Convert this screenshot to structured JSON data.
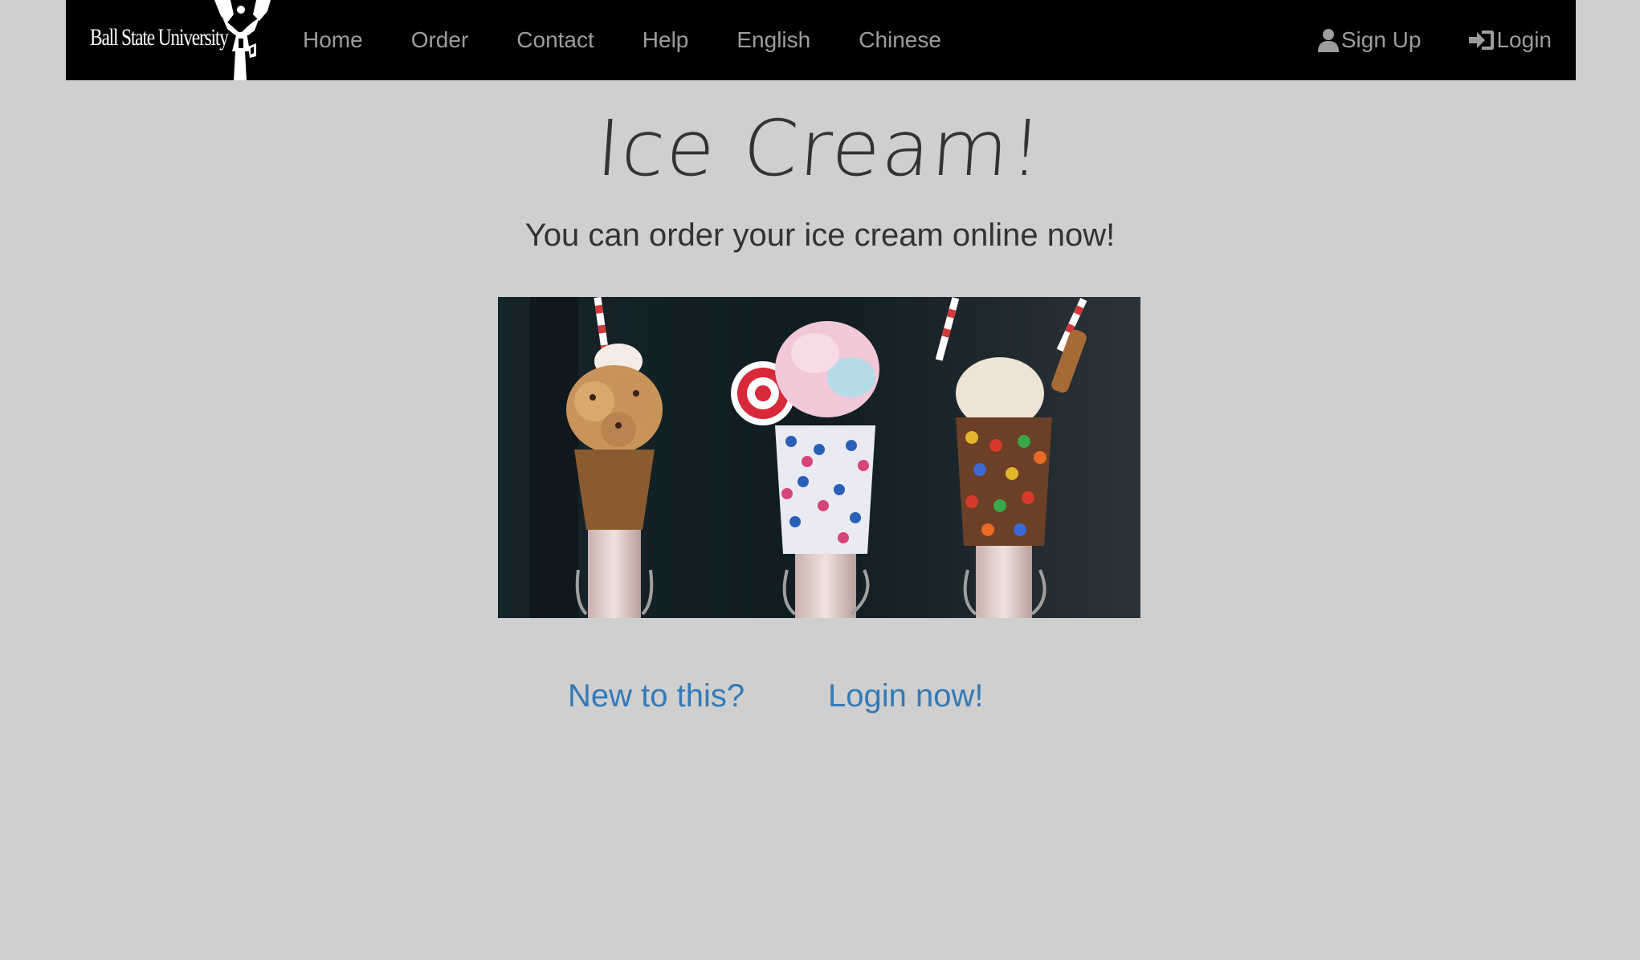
{
  "navbar": {
    "brand_text": "Ball State University",
    "brand_logo_icon": "cardinal-statue-icon",
    "left_links": [
      "Home",
      "Order",
      "Contact",
      "Help",
      "English",
      "Chinese"
    ],
    "signup_label": "Sign Up",
    "signup_icon": "user-icon",
    "login_label": "Login",
    "login_icon": "log-in-icon"
  },
  "hero": {
    "title": "Ice Cream!",
    "subtitle": "You can order your ice cream online now!",
    "image_subject": "three milkshakes topped with cookies, cotton candy, candy buttons, straws and lollipops"
  },
  "actions": {
    "new_label": "New to this?",
    "login_now_label": "Login now!"
  },
  "colors": {
    "page_background": "#cfcfcf",
    "navbar_background": "#000000",
    "nav_link": "#9d9d9d",
    "link": "#337ab7",
    "heading": "#333333"
  }
}
